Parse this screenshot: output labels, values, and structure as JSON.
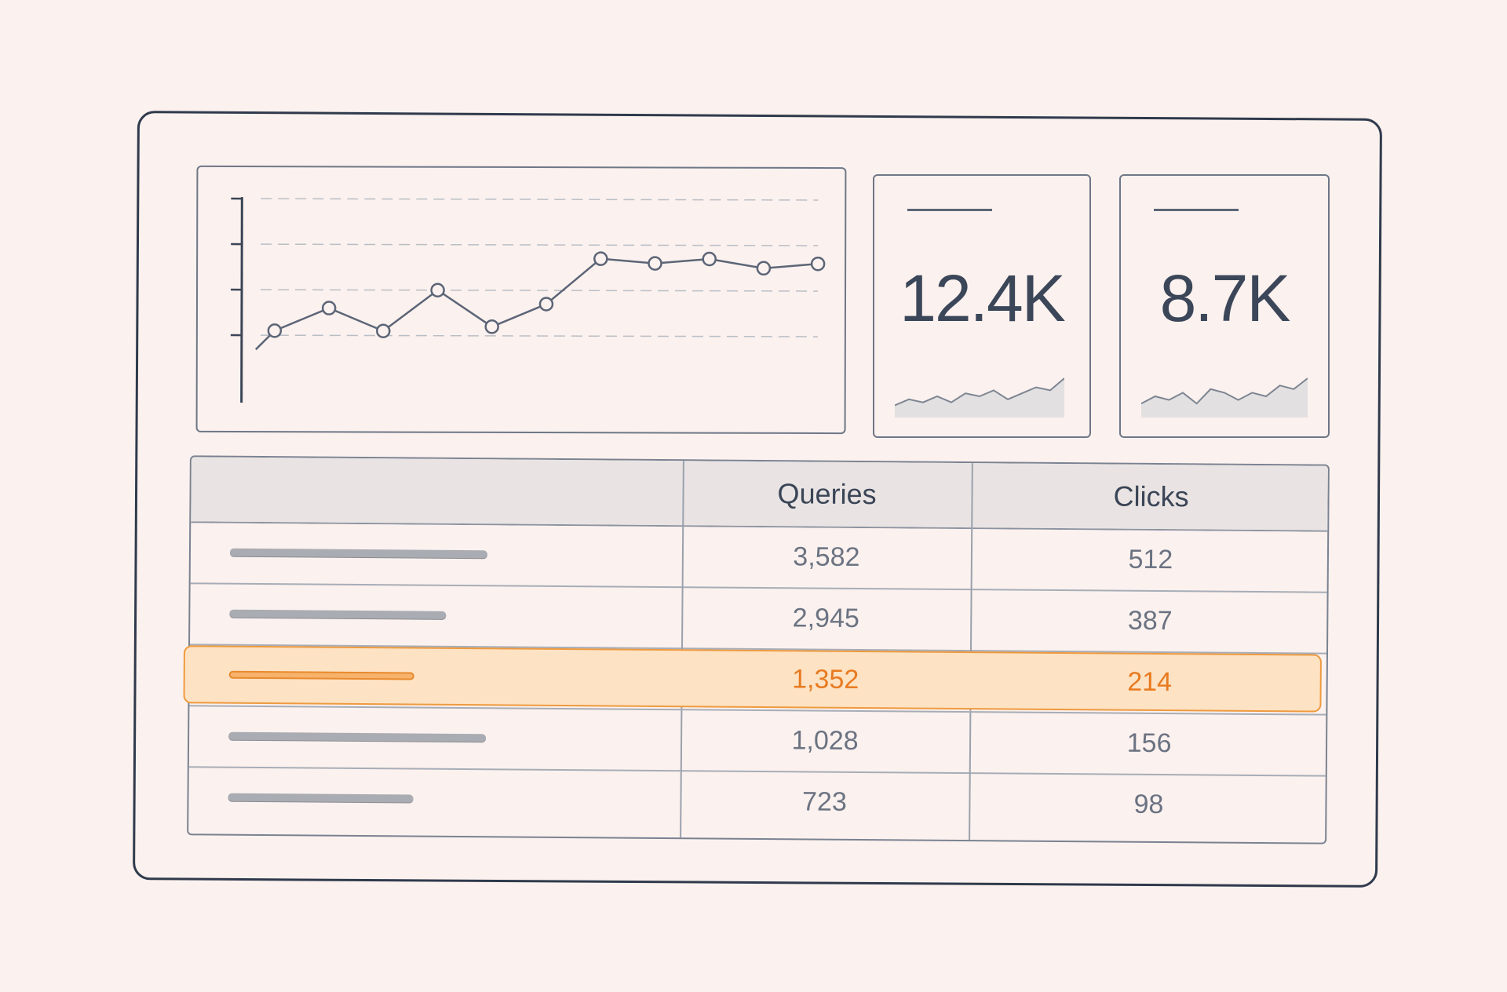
{
  "chart_data": {
    "type": "line",
    "x": [
      1,
      2,
      3,
      4,
      5,
      6,
      7,
      8,
      9,
      10,
      11
    ],
    "values": [
      1.1,
      1.6,
      1.1,
      2.0,
      1.2,
      1.7,
      2.7,
      2.6,
      2.7,
      2.5,
      2.6
    ],
    "ylim": [
      0,
      4
    ],
    "ticks_y": 4,
    "grid": true,
    "color": "#5c6577"
  },
  "kpis": [
    {
      "value": "12.4K",
      "spark": [
        3,
        5,
        4,
        6,
        4,
        7,
        6,
        8,
        5,
        7,
        9,
        8,
        12
      ]
    },
    {
      "value": "8.7K",
      "spark": [
        3,
        5,
        4,
        6,
        3,
        7,
        6,
        4,
        6,
        5,
        8,
        7,
        10
      ]
    }
  ],
  "table": {
    "headers": {
      "name": "",
      "queries": "Queries",
      "clicks": "Clicks"
    },
    "rows": [
      {
        "queries": "3,582",
        "clicks": "512",
        "bar": 0.82,
        "highlight": false
      },
      {
        "queries": "2,945",
        "clicks": "387",
        "bar": 0.69,
        "highlight": false
      },
      {
        "queries": "1,352",
        "clicks": "214",
        "bar": 0.59,
        "highlight": true
      },
      {
        "queries": "1,028",
        "clicks": "156",
        "bar": 0.82,
        "highlight": false
      },
      {
        "queries": "723",
        "clicks": "98",
        "bar": 0.59,
        "highlight": false
      }
    ]
  },
  "colors": {
    "accent": "#e87a20",
    "background": "#fbf1ee",
    "ink": "#2f3a4c"
  }
}
